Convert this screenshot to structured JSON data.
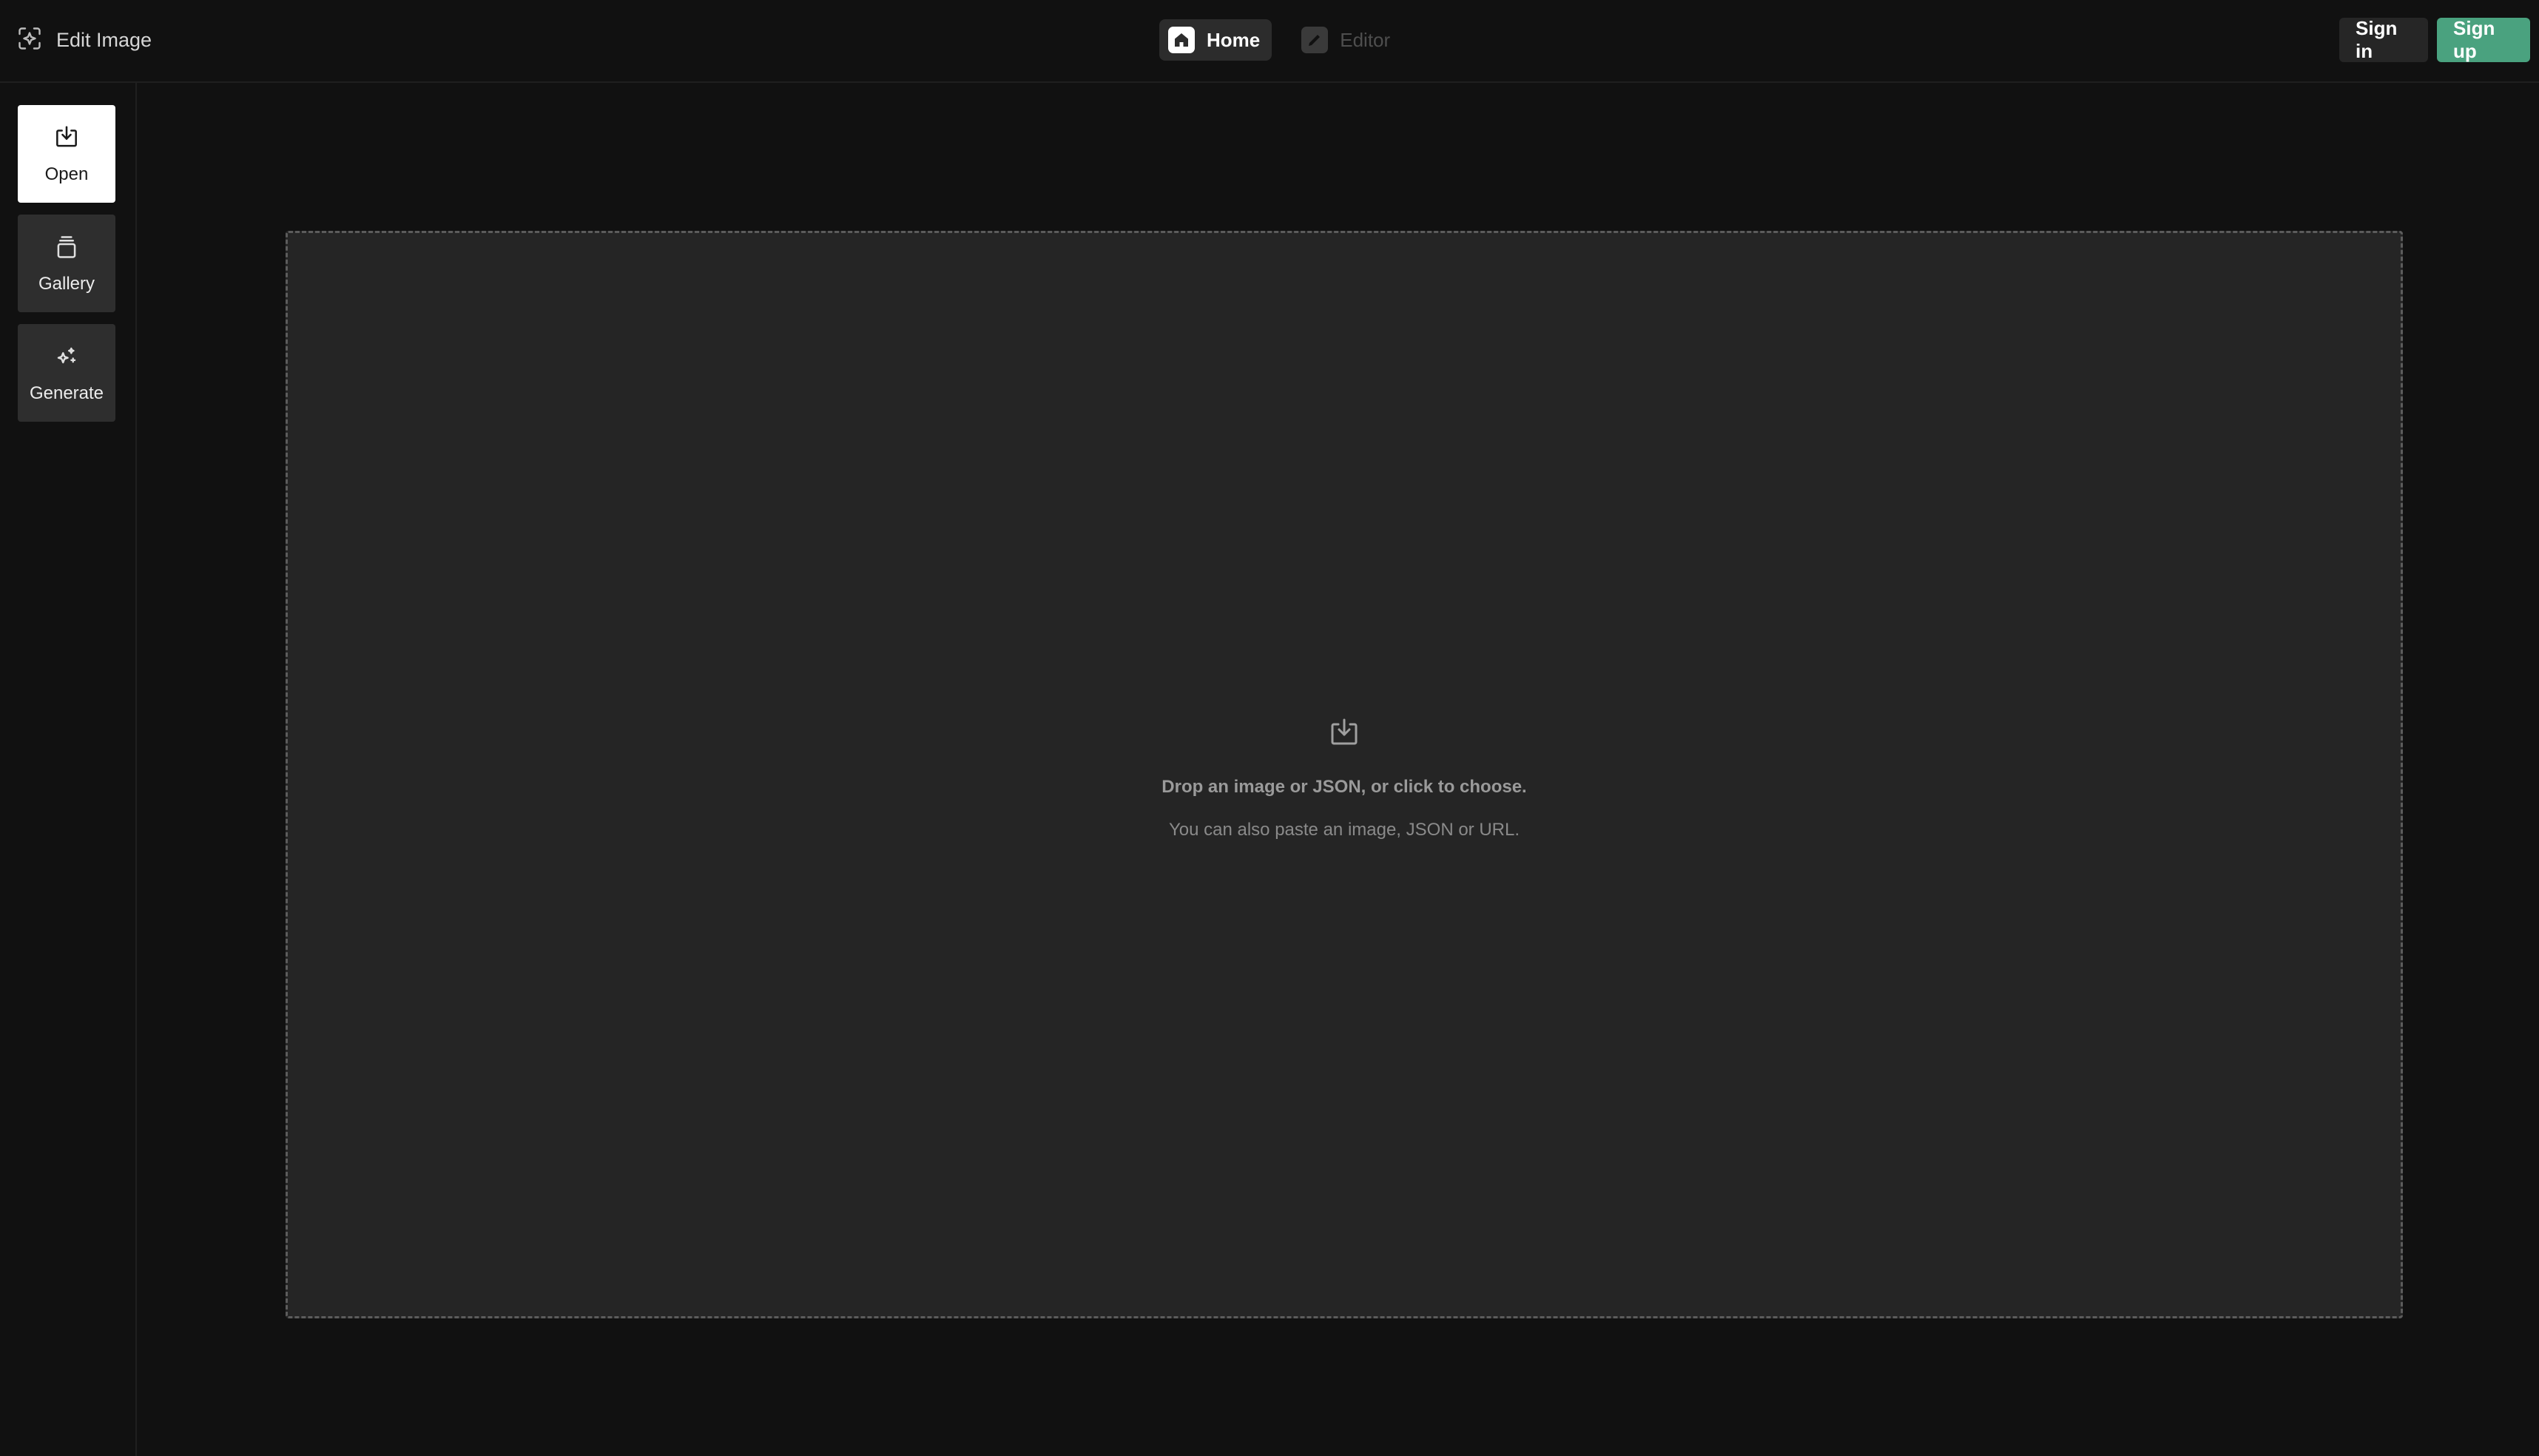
{
  "app": {
    "title": "Edit Image"
  },
  "nav": {
    "home_label": "Home",
    "editor_label": "Editor"
  },
  "auth": {
    "signin_label": "Sign in",
    "signup_label": "Sign up"
  },
  "sidebar": {
    "items": [
      {
        "label": "Open",
        "icon": "download-tray-icon",
        "active": true
      },
      {
        "label": "Gallery",
        "icon": "stack-icon",
        "active": false
      },
      {
        "label": "Generate",
        "icon": "sparkle-icon",
        "active": false
      }
    ]
  },
  "dropzone": {
    "title": "Drop an image or JSON, or click to choose.",
    "subtitle": "You can also paste an image, JSON or URL."
  },
  "colors": {
    "background": "#111111",
    "dropzone_bg": "#252525",
    "accent_green": "#4aa27f"
  }
}
